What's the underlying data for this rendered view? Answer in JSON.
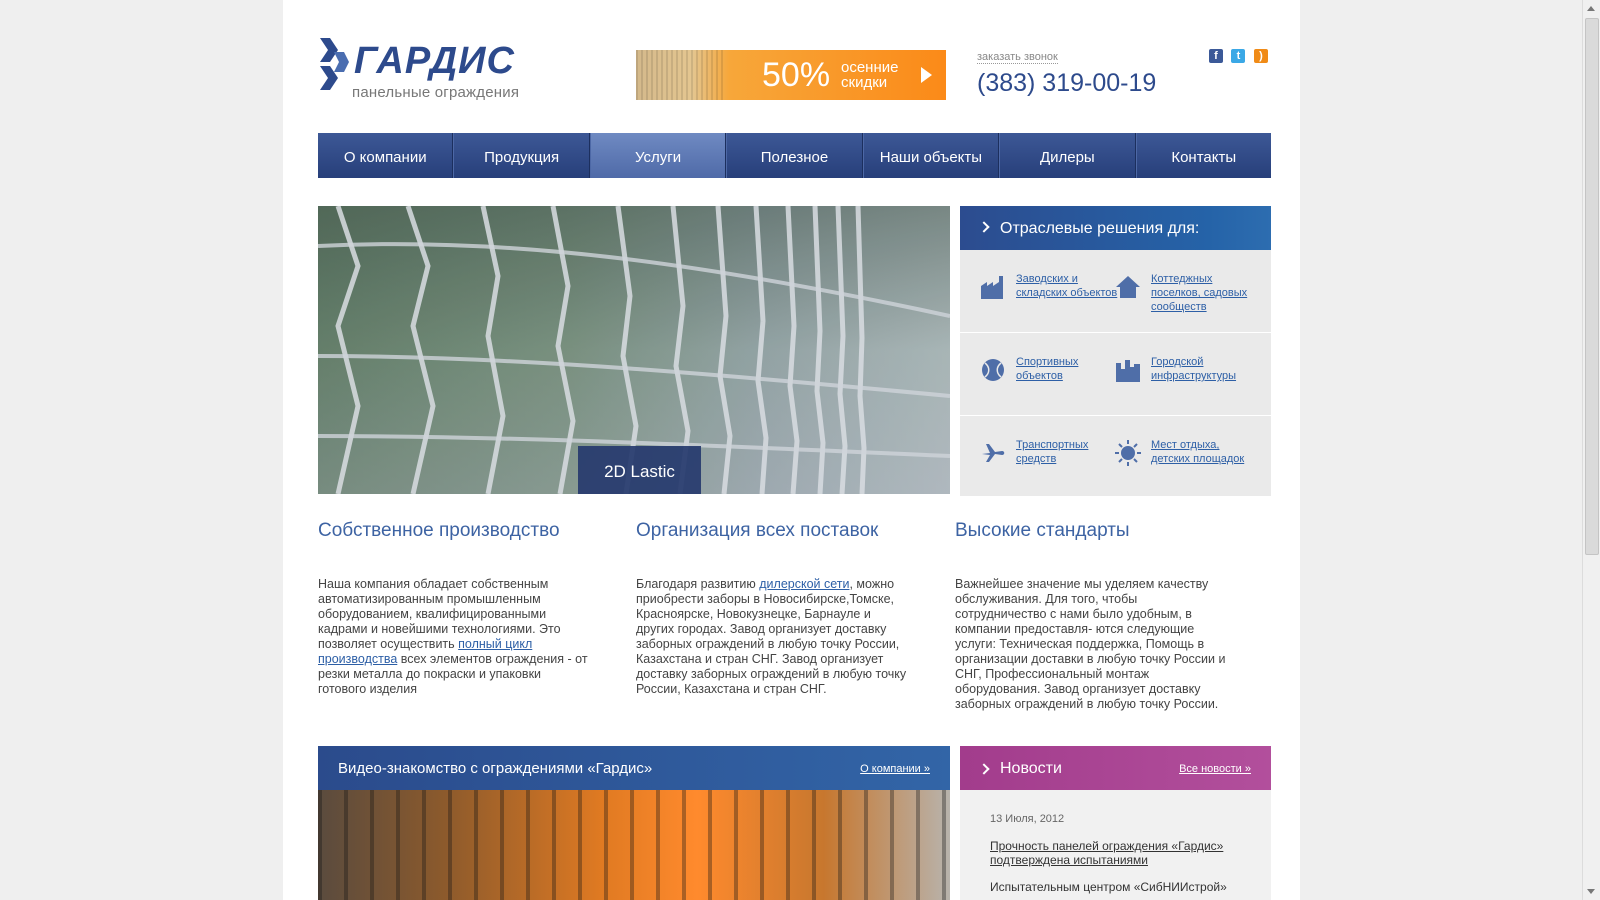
{
  "header": {
    "logo_text": "ГАРДИС",
    "logo_sub": "панельные ограждения",
    "promo_percent": "50%",
    "promo_line1": "осенние",
    "promo_line2": "скидки",
    "callback": "заказать звонок",
    "phone": "(383) 319-00-19",
    "social": [
      "facebook-icon",
      "twitter-icon",
      "rss-icon"
    ]
  },
  "nav": {
    "items": [
      "О компании",
      "Продукция",
      "Услуги",
      "Полезное",
      "Наши объекты",
      "Дилеры",
      "Контакты"
    ],
    "active_index": 2
  },
  "hero": {
    "caption": "2D Lastic"
  },
  "solutions": {
    "title": "Отраслевые решения для:",
    "items": [
      {
        "label": "Заводских и складских объектов",
        "icon": "factory-icon"
      },
      {
        "label": "Коттеджных поселков, садовых сообществ",
        "icon": "house-icon"
      },
      {
        "label": "Спортивных объектов",
        "icon": "ball-icon"
      },
      {
        "label": "Городской инфраструктуры",
        "icon": "city-icon"
      },
      {
        "label": "Транспортных средств",
        "icon": "plane-icon"
      },
      {
        "label": "Мест отдыха, детских площадок",
        "icon": "sun-icon"
      }
    ]
  },
  "columns": [
    {
      "title": "Собственное производство",
      "text_before": "Наша компания обладает собственным автоматизированным промышленным оборудованием, квалифицированными кадрами и новейшими технологиями. Это позволяет осуществить ",
      "link": "полный цикл производства",
      "text_after": " всех элементов ограждения - от резки металла до покраски и упаковки готового изделия"
    },
    {
      "title": "Организация всех поставок",
      "text_before": "Благодаря развитию ",
      "link": "дилерской сети",
      "text_after": ", можно приобрести заборы в Новосибирске,Томске, Красноярске, Новокузнецке, Барнауле и других городах. Завод организует доставку заборных ограждений в любую точку России, Казахстана и стран СНГ. Завод организует доставку заборных ограждений в любую точку России, Казахстана и стран СНГ."
    },
    {
      "title": "Высокие стандарты",
      "text_before": "Важнейшее значение мы уделяем качеству обслуживания. Для того, чтобы сотрудничество с нами было удобным, в компании предоставля- ются следующие услуги: Техническая поддержка, Помощь в организации доставки в любую точку России и СНГ, Профессиональный монтаж оборудования. Завод организует доставку заборных ограждений в любую точку России.",
      "link": "",
      "text_after": ""
    }
  ],
  "video": {
    "title": "Видео-знакомство с ограждениями «Гардис»",
    "link": "О компании »"
  },
  "news": {
    "title": "Новости",
    "all_link": "Все новости »",
    "date": "13 Июля, 2012",
    "headline": "Прочность панелей ограждения «Гардис» подтверждена испытаниями",
    "teaser": "Испытательным центром «СибНИИстрой»"
  },
  "colors": {
    "brand_blue": "#2d4a8c",
    "nav_bg": "#2f4a87",
    "promo_orange": "#fb8a18",
    "news_purple": "#a23c8c",
    "link_blue": "#2d5fa6"
  }
}
